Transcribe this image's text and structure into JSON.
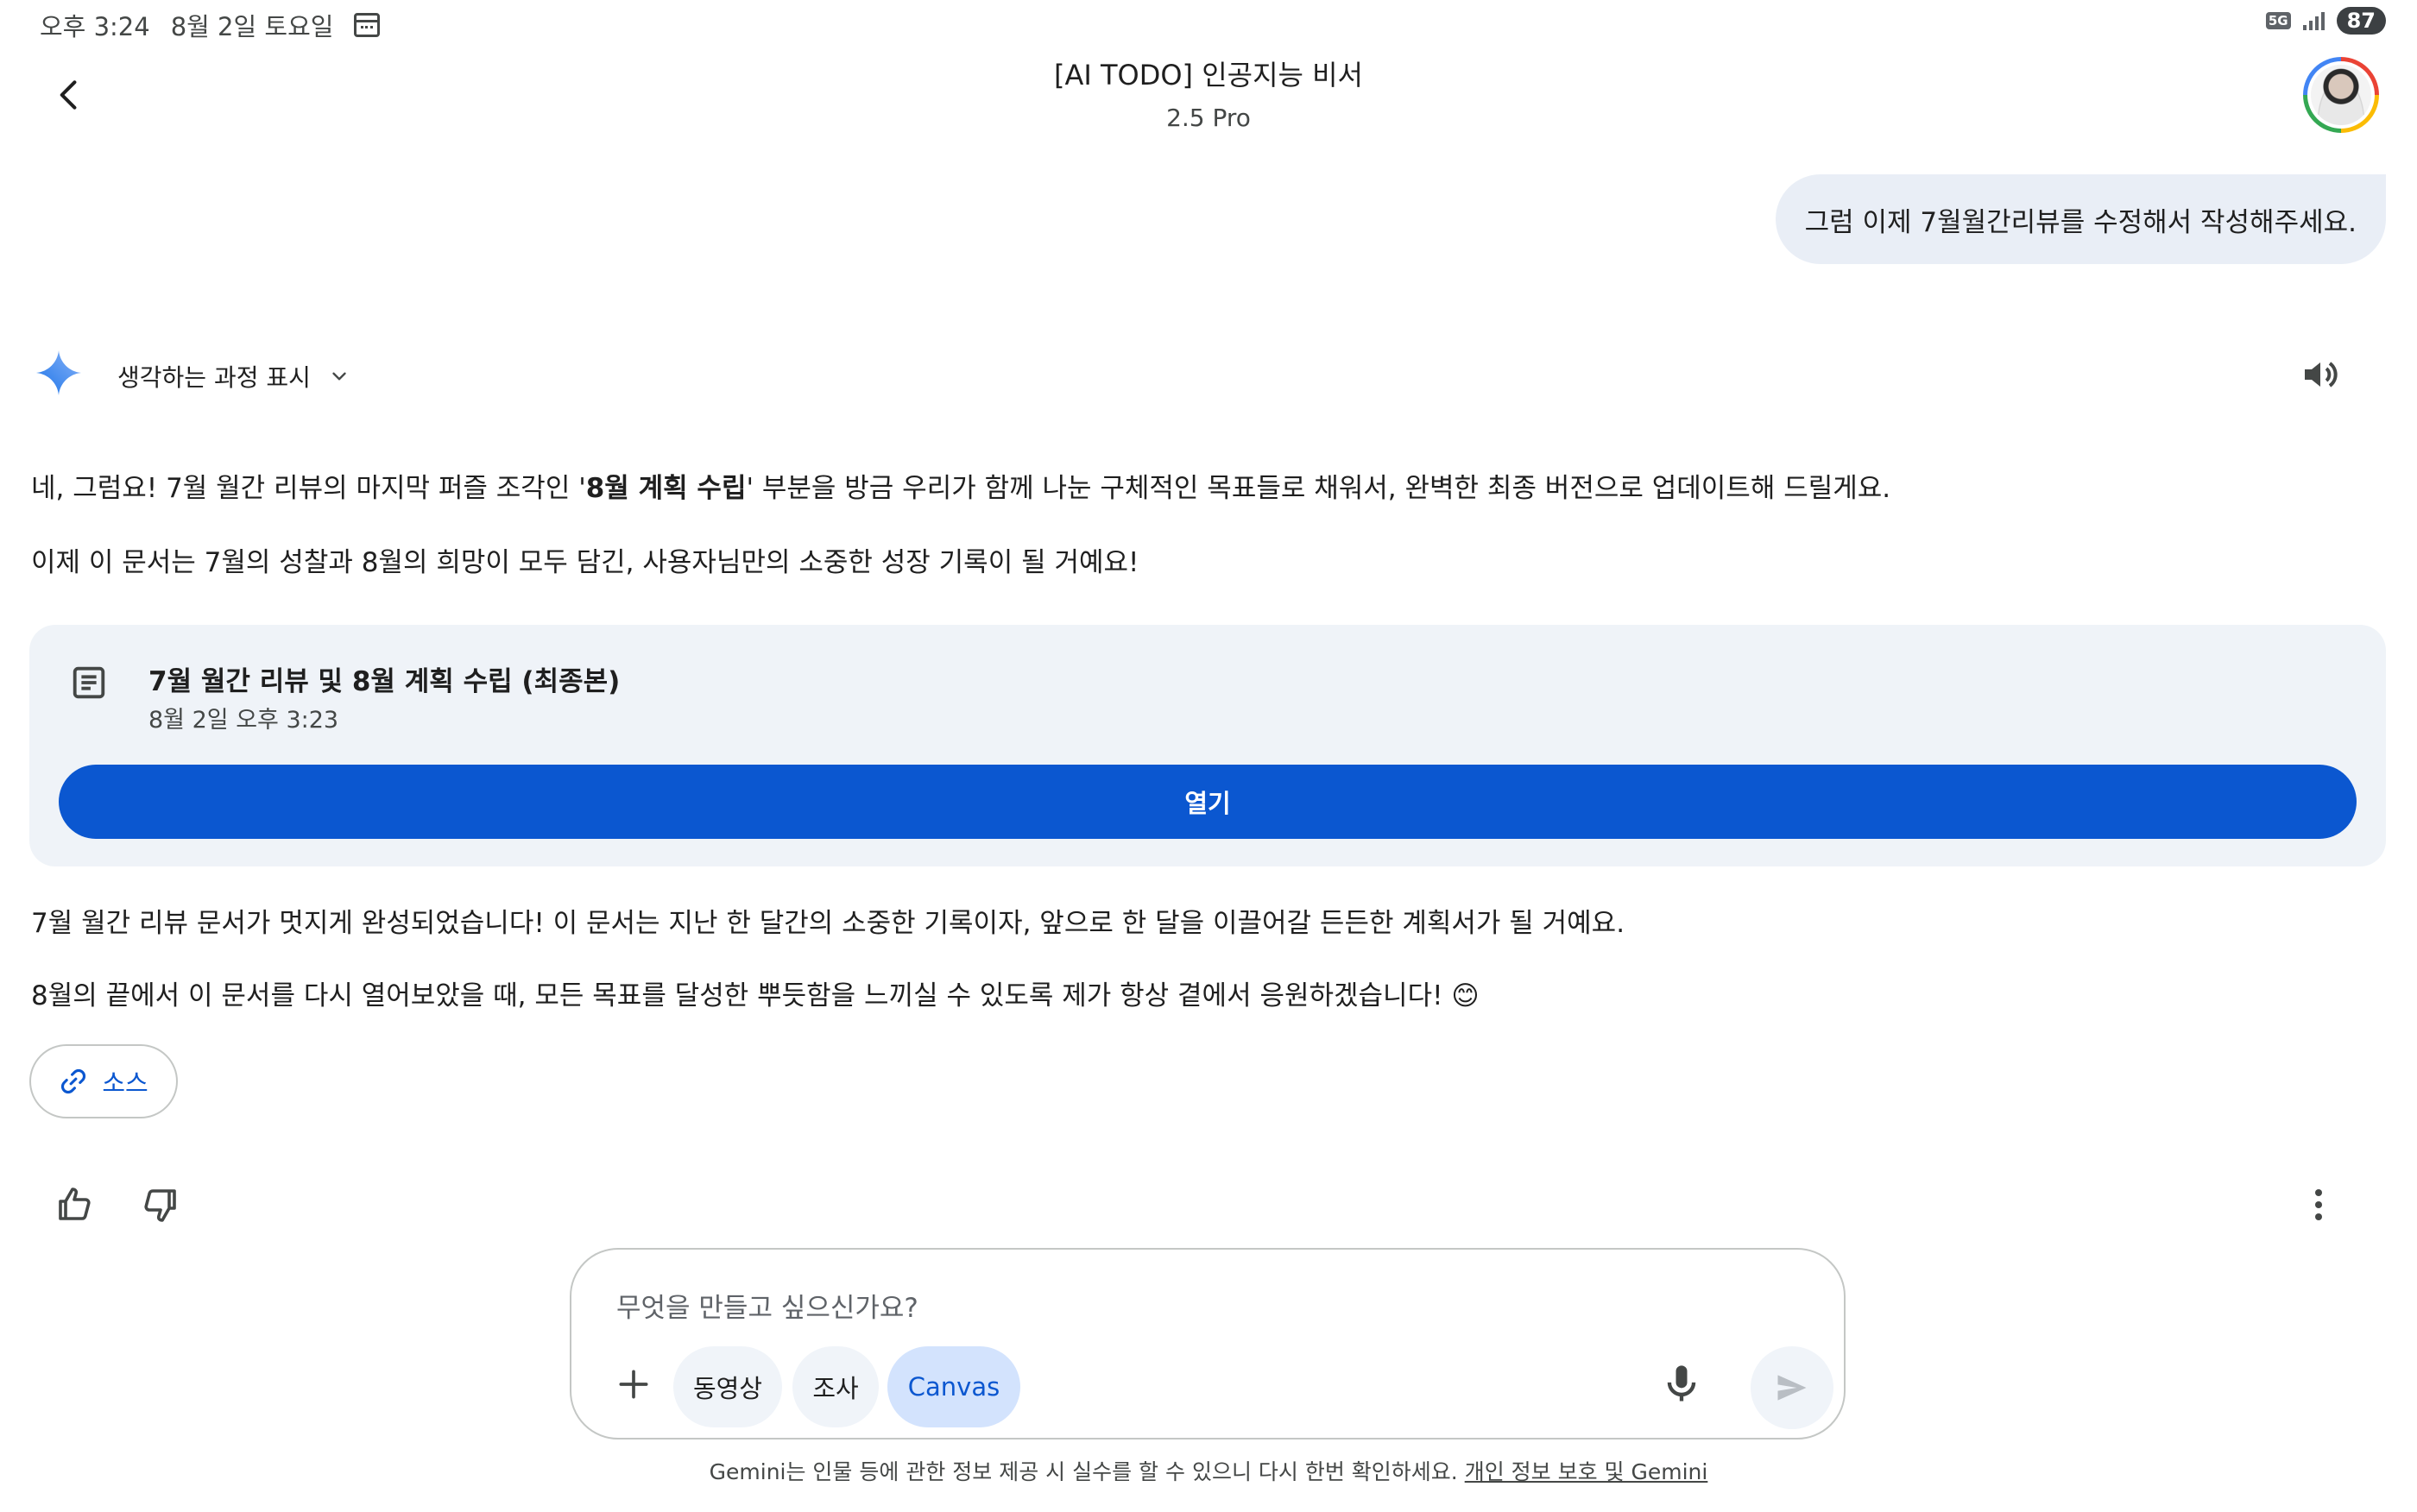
{
  "status_bar": {
    "time": "오후 3:24",
    "date": "8월 2일 토요일",
    "network": "5G",
    "battery": "87"
  },
  "header": {
    "title": "[AI TODO] 인공지능 비서",
    "model": "2.5 Pro"
  },
  "user_message": "그럼 이제 7월월간리뷰를 수정해서 작성해주세요.",
  "response": {
    "thinking_label": "생각하는 과정 표시",
    "p1_before": "네, 그럼요! 7월 월간 리뷰의 마지막 퍼즐 조각인 '",
    "p1_bold": "8월 계획 수립",
    "p1_after": "' 부분을 방금 우리가 함께 나눈 구체적인 목표들로 채워서, 완벽한 최종 버전으로 업데이트해 드릴게요.",
    "p2": "이제 이 문서는 7월의 성찰과 8월의 희망이 모두 담긴, 사용자님만의 소중한 성장 기록이 될 거예요!",
    "doc_card": {
      "title": "7월 월간 리뷰 및 8월 계획 수립 (최종본)",
      "timestamp": "8월 2일 오후 3:23",
      "open_label": "열기"
    },
    "p3": "7월 월간 리뷰 문서가 멋지게 완성되었습니다! 이 문서는 지난 한 달간의 소중한 기록이자, 앞으로 한 달을 이끌어갈 든든한 계획서가 될 거예요.",
    "p4": "8월의 끝에서 이 문서를 다시 열어보았을 때, 모든 목표를 달성한 뿌듯함을 느끼실 수 있도록 제가 항상 곁에서 응원하겠습니다! 😊",
    "source_label": "소스"
  },
  "input": {
    "placeholder": "무엇을 만들고 싶으신가요?",
    "chips": [
      "동영상",
      "조사",
      "Canvas"
    ]
  },
  "footer": {
    "disclaimer": "Gemini는 인물 등에 관한 정보 제공 시 실수를 할 수 있으니 다시 한번 확인하세요. ",
    "privacy_link": "개인 정보 보호 및 Gemini"
  },
  "colors": {
    "accent_blue": "#0b57d0",
    "bubble_bg": "#e9eef6",
    "card_bg": "#eff3f8"
  },
  "icons": [
    "calendar-icon",
    "back-arrow-icon",
    "gemini-star-icon",
    "chevron-down-icon",
    "speaker-icon",
    "document-icon",
    "link-icon",
    "thumbs-up-icon",
    "thumbs-down-icon",
    "more-vert-icon",
    "plus-icon",
    "mic-icon",
    "send-icon"
  ]
}
